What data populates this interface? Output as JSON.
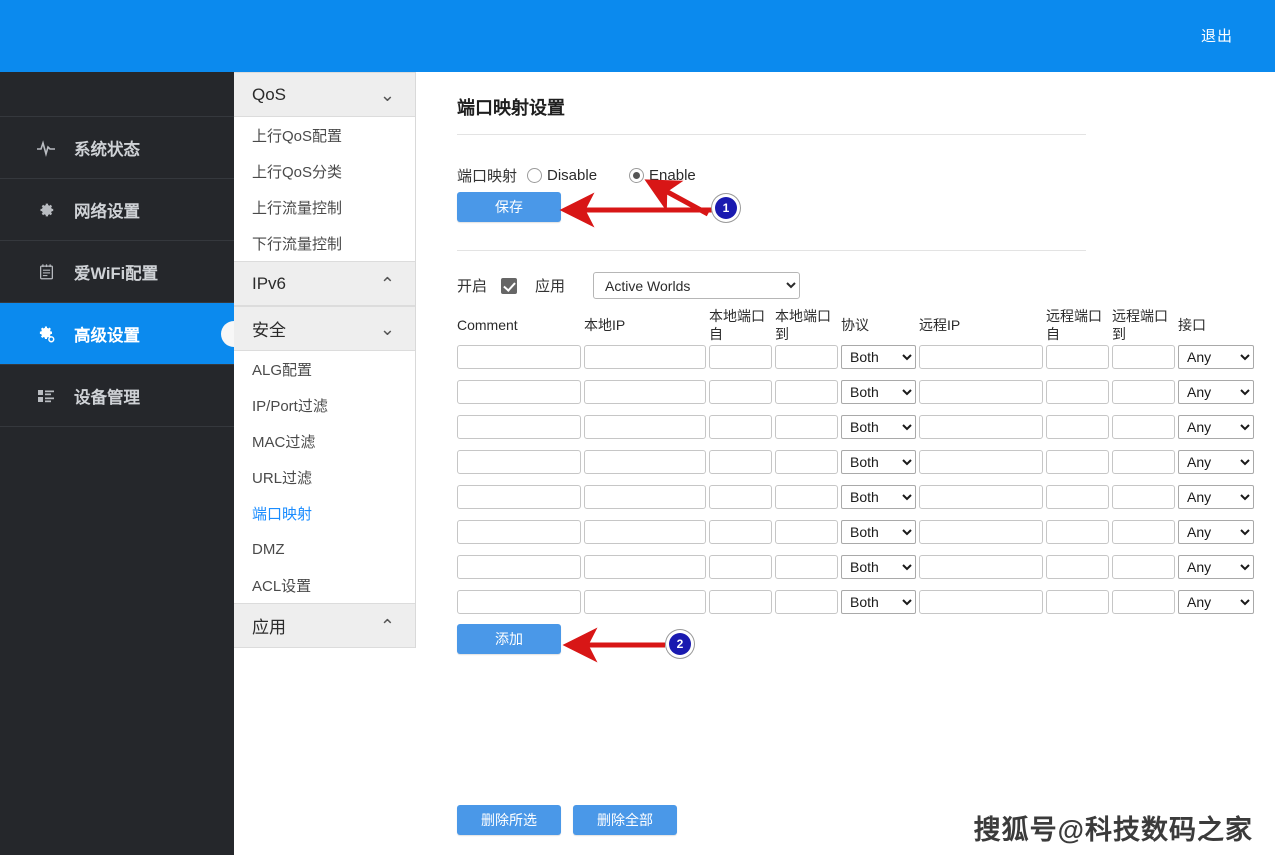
{
  "topbar": {
    "logout_label": "退出",
    "bg": "#0b8aee"
  },
  "sidebar": {
    "items": [
      {
        "label": "系统状态",
        "icon": "activity-icon",
        "active": false
      },
      {
        "label": "网络设置",
        "icon": "gear-icon",
        "active": false
      },
      {
        "label": "爱WiFi配置",
        "icon": "notepad-icon",
        "active": false
      },
      {
        "label": "高级设置",
        "icon": "gears-icon",
        "active": true
      },
      {
        "label": "设备管理",
        "icon": "list-icon",
        "active": false
      }
    ]
  },
  "submenu": {
    "groups": [
      {
        "label": "QoS",
        "chevron": "down",
        "links": [
          "上行QoS配置",
          "上行QoS分类",
          "上行流量控制",
          "下行流量控制"
        ]
      },
      {
        "label": "IPv6",
        "chevron": "up",
        "links": []
      },
      {
        "label": "安全",
        "chevron": "down",
        "links": [
          "ALG配置",
          "IP/Port过滤",
          "MAC过滤",
          "URL过滤",
          "端口映射",
          "DMZ",
          "ACL设置"
        ]
      },
      {
        "label": "应用",
        "chevron": "up",
        "links": []
      }
    ],
    "selected_link": "端口映射",
    "selected_color": "#1a8cff"
  },
  "main": {
    "page_title": "端口映射设置",
    "enable_row": {
      "label": "端口映射",
      "options": [
        {
          "label": "Disable",
          "checked": false
        },
        {
          "label": "Enable",
          "checked": true
        }
      ]
    },
    "save_label": "保存",
    "add_label": "添加",
    "delete_selected_label": "删除所选",
    "delete_all_label": "删除全部",
    "app_row": {
      "enable_label": "开启",
      "enabled": true,
      "app_label": "应用",
      "app_value": "Active Worlds"
    },
    "table": {
      "headers": [
        "Comment",
        "本地IP",
        "本地端口\n自",
        "本地端口\n到",
        "协议",
        "远程IP",
        "远程端口\n自",
        "远程端口\n到",
        "接口"
      ],
      "header_parts": [
        {
          "l1": "Comment",
          "l2": ""
        },
        {
          "l1": "本地IP",
          "l2": ""
        },
        {
          "l1": "本地端口",
          "l2": "自"
        },
        {
          "l1": "本地端口",
          "l2": "到"
        },
        {
          "l1": "协议",
          "l2": ""
        },
        {
          "l1": "远程IP",
          "l2": ""
        },
        {
          "l1": "远程端口",
          "l2": "自"
        },
        {
          "l1": "远程端口",
          "l2": "到"
        },
        {
          "l1": "接口",
          "l2": ""
        }
      ],
      "row_count": 8,
      "protocol_value": "Both",
      "interface_value": "Any",
      "rows": [
        {
          "comment": "",
          "local_ip": "",
          "local_port_from": "",
          "local_port_to": "",
          "protocol": "Both",
          "remote_ip": "",
          "remote_port_from": "",
          "remote_port_to": "",
          "interface": "Any"
        },
        {
          "comment": "",
          "local_ip": "",
          "local_port_from": "",
          "local_port_to": "",
          "protocol": "Both",
          "remote_ip": "",
          "remote_port_from": "",
          "remote_port_to": "",
          "interface": "Any"
        },
        {
          "comment": "",
          "local_ip": "",
          "local_port_from": "",
          "local_port_to": "",
          "protocol": "Both",
          "remote_ip": "",
          "remote_port_from": "",
          "remote_port_to": "",
          "interface": "Any"
        },
        {
          "comment": "",
          "local_ip": "",
          "local_port_from": "",
          "local_port_to": "",
          "protocol": "Both",
          "remote_ip": "",
          "remote_port_from": "",
          "remote_port_to": "",
          "interface": "Any"
        },
        {
          "comment": "",
          "local_ip": "",
          "local_port_from": "",
          "local_port_to": "",
          "protocol": "Both",
          "remote_ip": "",
          "remote_port_from": "",
          "remote_port_to": "",
          "interface": "Any"
        },
        {
          "comment": "",
          "local_ip": "",
          "local_port_from": "",
          "local_port_to": "",
          "protocol": "Both",
          "remote_ip": "",
          "remote_port_from": "",
          "remote_port_to": "",
          "interface": "Any"
        },
        {
          "comment": "",
          "local_ip": "",
          "local_port_from": "",
          "local_port_to": "",
          "protocol": "Both",
          "remote_ip": "",
          "remote_port_from": "",
          "remote_port_to": "",
          "interface": "Any"
        },
        {
          "comment": "",
          "local_ip": "",
          "local_port_from": "",
          "local_port_to": "",
          "protocol": "Both",
          "remote_ip": "",
          "remote_port_from": "",
          "remote_port_to": "",
          "interface": "Any"
        }
      ]
    }
  },
  "annotations": {
    "badge1": "1",
    "badge2": "2",
    "arrow_color": "#d81616",
    "badge_color": "#1a1ab0"
  },
  "watermark": {
    "text": "搜狐号@科技数码之家"
  }
}
